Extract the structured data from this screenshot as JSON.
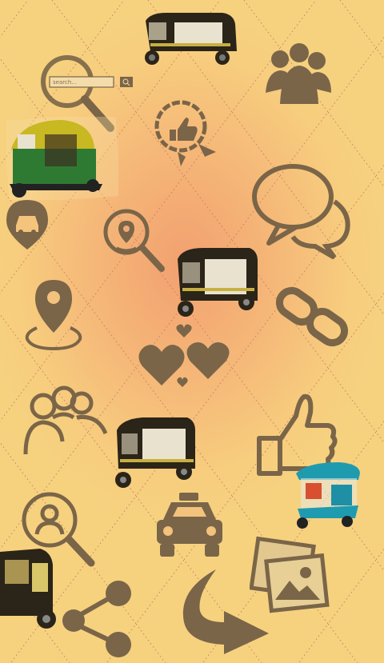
{
  "colors": {
    "icon": "#7a6548",
    "background_light": "#f7cd7e",
    "background_center": "#f2a070",
    "stitch": "#c98068"
  },
  "search_widget": {
    "placeholder": "search..."
  },
  "icons": [
    "auto-rickshaw-icon",
    "search-magnifier-icon",
    "people-group-icon",
    "thumbs-up-badge-icon",
    "chat-bubbles-icon",
    "location-search-icon",
    "map-pin-icon",
    "link-chain-icon",
    "hearts-icon",
    "team-icon",
    "thumbs-up-icon",
    "taxi-icon",
    "user-search-icon",
    "photo-gallery-icon",
    "curved-arrow-icon",
    "share-icon"
  ]
}
